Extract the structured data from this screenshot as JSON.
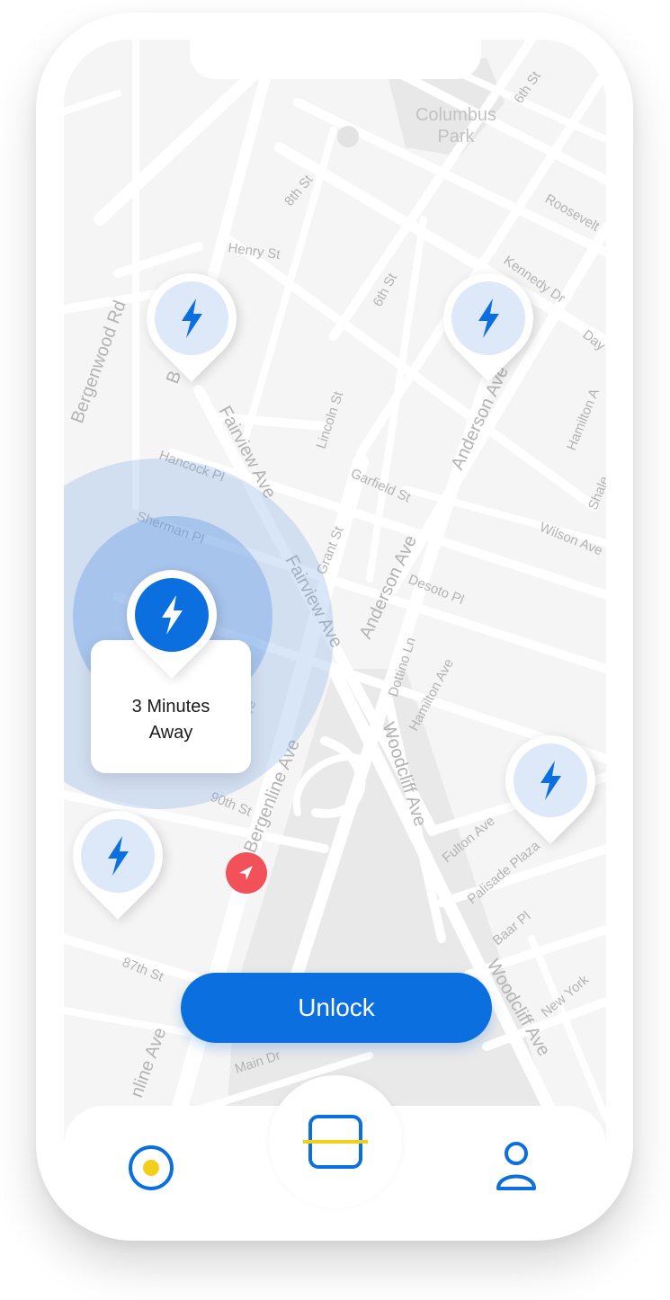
{
  "map": {
    "park_label_line1": "Columbus",
    "park_label_line2": "Park",
    "streets": {
      "sixth_st_top": "6th St",
      "eighth_st": "8th St",
      "henry_st": "Henry St",
      "sixth_st": "6th St",
      "roosevelt": "Roosevelt",
      "kennedy_dr": "Kennedy Dr",
      "day": "Day",
      "bergenwood_rd": "Bergenwood Rd",
      "b_fragment": "B",
      "fairview_ave_1": "Fairview Ave",
      "lincoln_st": "Lincoln St",
      "anderson_ave_1": "Anderson Ave",
      "hamilton": "Hamilton A",
      "hamilton_2": "Hamilton",
      "hancock_pl": "Hancock Pl",
      "garfield_st": "Garfield St",
      "shale": "Shale",
      "sherman_pl": "Sherman Pl",
      "fairview_ave_2": "Fairview Ave",
      "grant_st": "Grant St",
      "wilson_ave": "Wilson Ave",
      "anderson_ave_2": "Anderson Ave",
      "desoto_pl": "Desoto Pl",
      "dottino_ln": "Dottino Ln",
      "hamilton_ave": "Hamilton Ave",
      "ave_fragment": "ve",
      "woodcliff_ave_1": "Woodcliff Ave",
      "bergenline_ave_1": "Bergenline Ave",
      "ninetieth_st": "90th St",
      "fulton_ave": "Fulton Ave",
      "palisade_plaza": "Palisade Plaza",
      "baar_pl": "Baar Pl",
      "eightyseventh_st": "87th St",
      "new_york": "New York",
      "woodcliff_ave_2": "Woodcliff Ave",
      "bergenline_ave_2": "nline Ave",
      "main_dr": "Main Dr"
    }
  },
  "callout": {
    "line1": "3 Minutes",
    "line2": "Away"
  },
  "unlock_label": "Unlock",
  "colors": {
    "accent": "#0b6fe0",
    "pin_light": "#dde9f8",
    "nav_red": "#f2515a",
    "home_dot": "#f2cf1b"
  },
  "icons": {
    "station_pin": "bolt-icon",
    "navigation": "location-arrow-icon",
    "home": "home-dot-icon",
    "scan": "scan-icon",
    "profile": "user-icon"
  }
}
